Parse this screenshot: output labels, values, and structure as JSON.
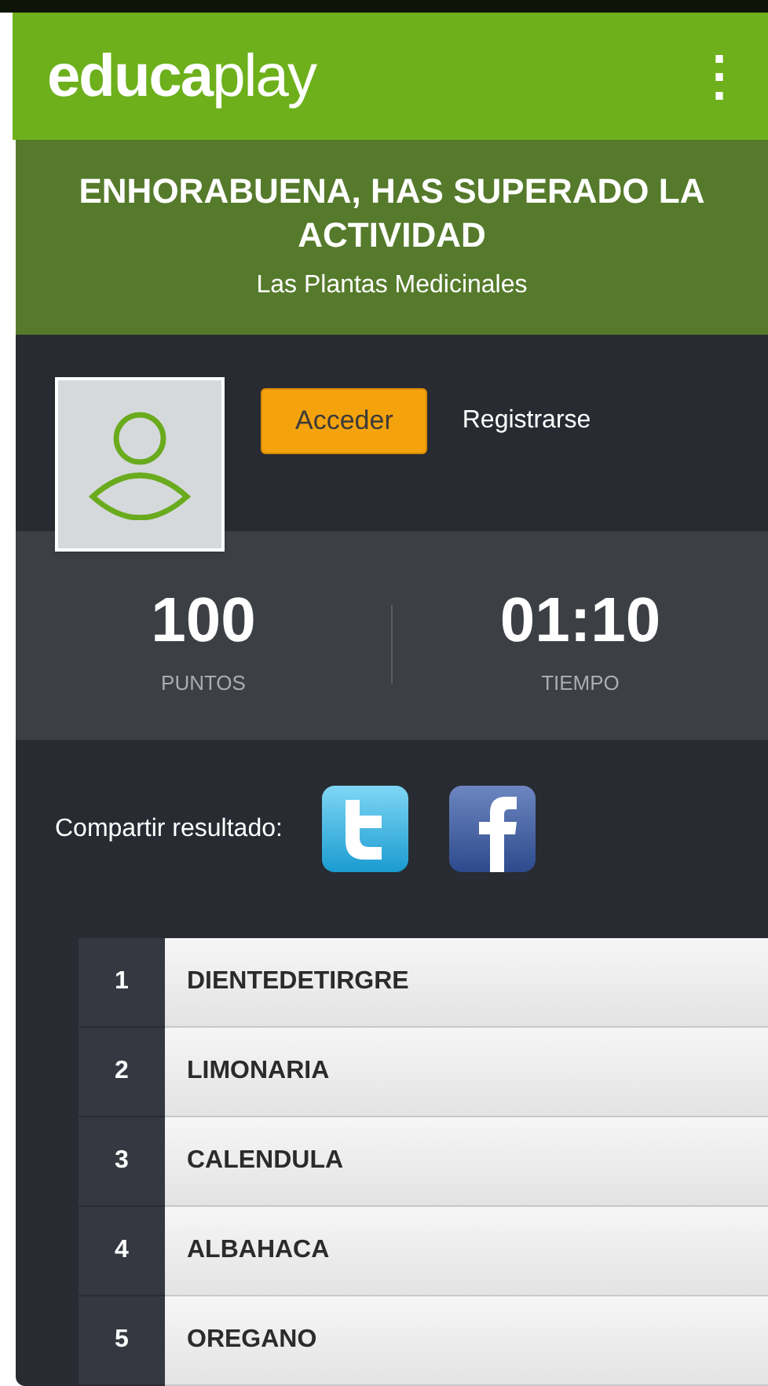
{
  "header": {
    "logo": "**educa**play",
    "menu_icon": "⋮"
  },
  "banner": {
    "title": "ENHORABUENA, HAS SUPERADO LA ACTIVIDAD",
    "subtitle": "Las Plantas Medicinales"
  },
  "account": {
    "login_button": "Acceder",
    "register_link": "Registrarse"
  },
  "stats": [
    {
      "value": "100",
      "label": "PUNTOS"
    },
    {
      "value": "01:10",
      "label": "TIEMPO"
    }
  ],
  "share": {
    "label": "Compartir resultado:",
    "networks": [
      {
        "kind": "twitter"
      },
      {
        "kind": "facebook"
      }
    ]
  },
  "answers": [
    {
      "number": "1",
      "text": "DIENTEDETIRGRE"
    },
    {
      "number": "2",
      "text": "LIMONARIA"
    },
    {
      "number": "3",
      "text": "CALENDULA"
    },
    {
      "number": "4",
      "text": "ALBAHACA"
    },
    {
      "number": "5",
      "text": "OREGANO"
    }
  ]
}
